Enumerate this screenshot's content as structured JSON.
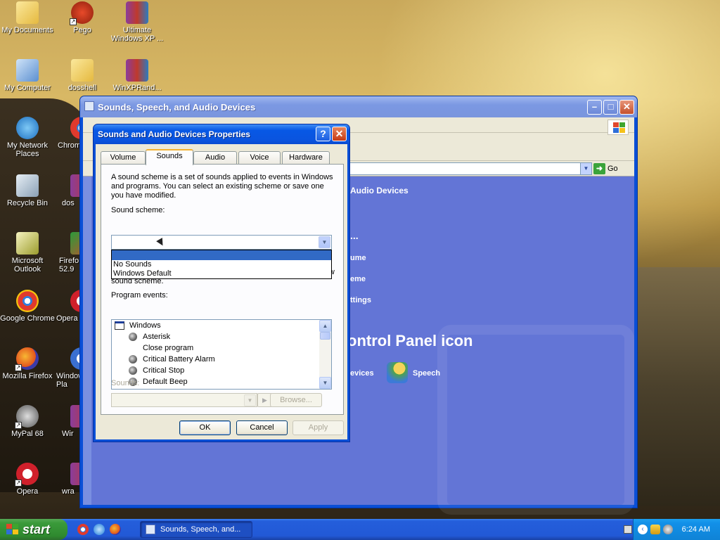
{
  "desktop": {
    "icons": [
      {
        "label": "My Documents"
      },
      {
        "label": "Pego"
      },
      {
        "label": "Ultimate Windows XP ..."
      },
      {
        "label": "My Computer"
      },
      {
        "label": "dosshell"
      },
      {
        "label": "WinXPRand..."
      },
      {
        "label": "My Network Places"
      },
      {
        "label": "Chrom"
      },
      {
        "label": "Recycle Bin"
      },
      {
        "label": "dos"
      },
      {
        "label": "Microsoft Outlook"
      },
      {
        "label": "Firefo 52.9"
      },
      {
        "label": "Google Chrome"
      },
      {
        "label": "Opera"
      },
      {
        "label": "Mozilla Firefox"
      },
      {
        "label": "Window Pla"
      },
      {
        "label": "MyPal 68"
      },
      {
        "label": "Wir"
      },
      {
        "label": "Opera"
      },
      {
        "label": "wra"
      }
    ]
  },
  "explorer": {
    "title": "Sounds, Speech, and Audio Devices",
    "go_label": "Go",
    "panel_heading": "Audio Devices",
    "pick_task": "...",
    "task_1": "ume",
    "task_2": "eme",
    "task_3": "ttings",
    "pick_icon": "ontrol Panel icon",
    "icon_1": "evices",
    "icon_2": "Speech"
  },
  "dialog": {
    "title": "Sounds and Audio Devices Properties",
    "help_glyph": "?",
    "close_glyph": "✕",
    "tabs": [
      "Volume",
      "Sounds",
      "Audio",
      "Voice",
      "Hardware"
    ],
    "intro_text": "A sound scheme is a set of sounds applied to events in Windows and programs. You can select an existing scheme or save one you have modified.",
    "scheme_label": "Sound scheme:",
    "scheme_value": "",
    "scheme_options": [
      "",
      "No Sounds",
      "Windows Default"
    ],
    "events_text": "To change sounds, click a program event in the following list and then select a sound to apply. You can save the changes as a new sound scheme.",
    "events_label": "Program events:",
    "events": [
      {
        "label": "Windows",
        "icon": "window-icon"
      },
      {
        "label": "Asterisk",
        "icon": "speaker-icon"
      },
      {
        "label": "Close program",
        "icon": ""
      },
      {
        "label": "Critical Battery Alarm",
        "icon": "speaker-icon"
      },
      {
        "label": "Critical Stop",
        "icon": "speaker-icon"
      },
      {
        "label": "Default Beep",
        "icon": "speaker-icon"
      }
    ],
    "sounds_label": "Sounds:",
    "browse_label": "Browse...",
    "ok_label": "OK",
    "cancel_label": "Cancel",
    "apply_label": "Apply"
  },
  "taskbar": {
    "start_label": "start",
    "task_label": "Sounds, Speech, and...",
    "clock": "6:24 AM"
  }
}
